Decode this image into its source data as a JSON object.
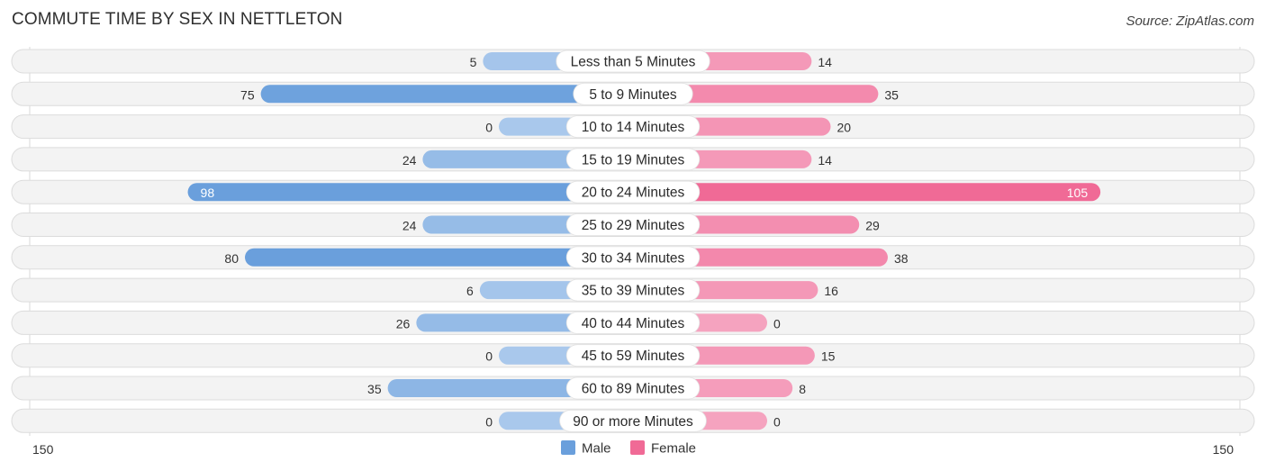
{
  "title": "COMMUTE TIME BY SEX IN NETTLETON",
  "source": "Source: ZipAtlas.com",
  "chart_data": {
    "type": "bar",
    "orientation": "horizontal-diverging",
    "title": "COMMUTE TIME BY SEX IN NETTLETON",
    "categories": [
      "Less than 5 Minutes",
      "5 to 9 Minutes",
      "10 to 14 Minutes",
      "15 to 19 Minutes",
      "20 to 24 Minutes",
      "25 to 29 Minutes",
      "30 to 34 Minutes",
      "35 to 39 Minutes",
      "40 to 44 Minutes",
      "45 to 59 Minutes",
      "60 to 89 Minutes",
      "90 or more Minutes"
    ],
    "series": [
      {
        "name": "Male",
        "color": "#6a9fdc",
        "color_light": "#a9c8ec",
        "values": [
          5,
          75,
          0,
          24,
          98,
          24,
          80,
          6,
          26,
          0,
          35,
          0
        ]
      },
      {
        "name": "Female",
        "color": "#f06a96",
        "color_light": "#f5a3bf",
        "values": [
          14,
          35,
          20,
          14,
          105,
          29,
          38,
          16,
          0,
          15,
          8,
          0
        ]
      }
    ],
    "axis_ticks": {
      "left": "150",
      "right": "150"
    },
    "xlim": [
      -150,
      150
    ],
    "legend": {
      "position": "bottom-center",
      "entries": [
        "Male",
        "Female"
      ]
    },
    "grid": false
  }
}
